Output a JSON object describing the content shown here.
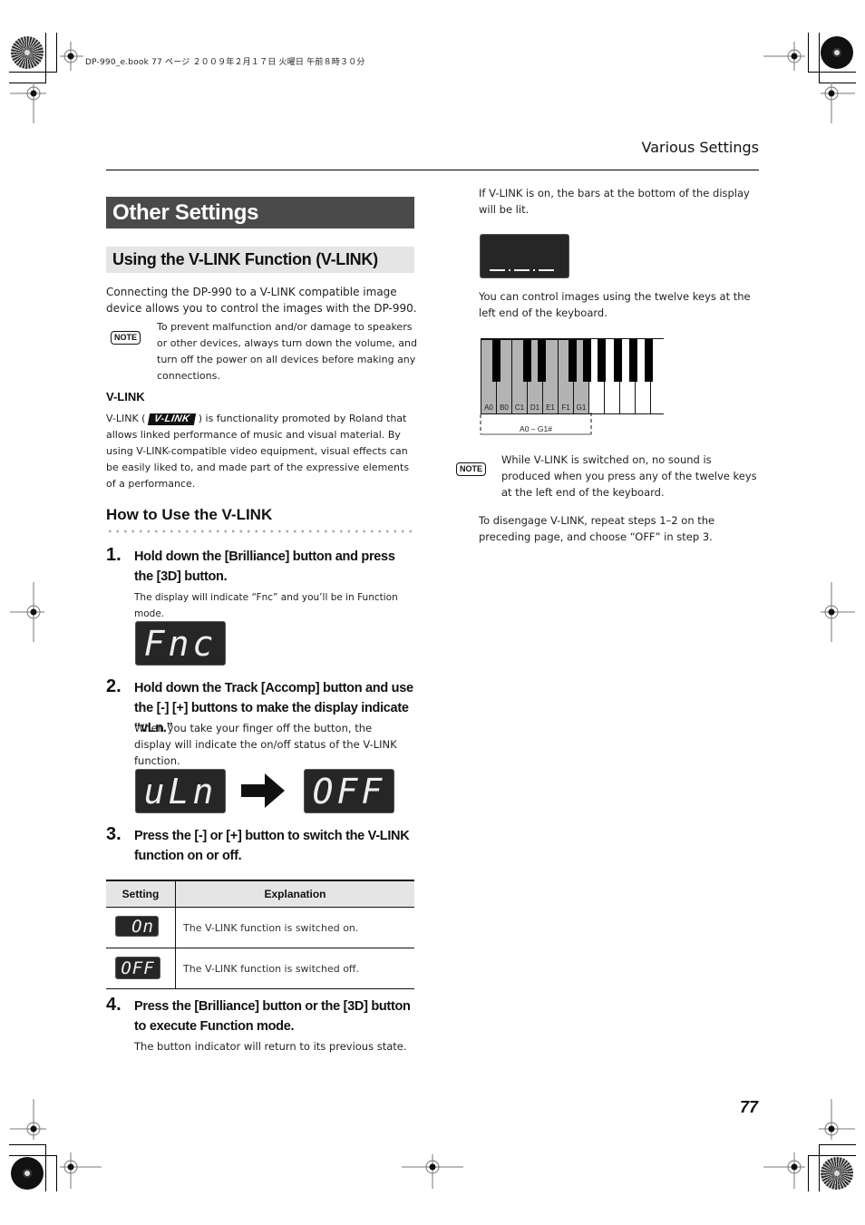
{
  "print_info": "DP-990_e.book  77 ページ  ２００９年２月１７日  火曜日  午前８時３０分",
  "running_head": "Various Settings",
  "page_number": "77",
  "title": "Other Settings",
  "section_title": "Using the V-LINK Function (V-LINK)",
  "intro": "Connecting the DP-990 to a V-LINK compatible image device allows you to control the images with the DP-990.",
  "note_label": "NOTE",
  "note1": "To prevent malfunction and/or damage to speakers or other devices, always turn down the volume, and turn off the power on all devices before making any connections.",
  "vlink": {
    "heading": "V-LINK",
    "text_before_logo": "V-LINK (",
    "logo": "V-LINK",
    "text_after_logo": ") is functionality promoted by Roland that allows linked performance of music and visual material. By using V-LINK-compatible video equipment, visual effects can be easily liked to, and made part of the expressive elements of a performance."
  },
  "howto_heading": "How to Use the V-LINK",
  "steps": [
    {
      "num": "1.",
      "title": "Hold down the [Brilliance] button and press the [3D] button.",
      "desc": "The display will indicate “Fnc” and you’ll be in Function mode.",
      "display": "Fnc"
    },
    {
      "num": "2.",
      "title": "Hold down the Track [Accomp] button and use the [-] [+] buttons to make the display indicate “vLn.”",
      "desc": "When you take your finger off the button, the display will indicate the on/off status of the V-LINK function.",
      "display_from": "uLn",
      "display_to": "OFF"
    },
    {
      "num": "3.",
      "title": "Press the [-] or [+] button to switch the V-LINK function on or off."
    },
    {
      "num": "4.",
      "title": "Press the [Brilliance] button or the [3D] button to execute Function mode.",
      "desc": "The button indicator will return to its previous state."
    }
  ],
  "settings_table": {
    "headers": [
      "Setting",
      "Explanation"
    ],
    "rows": [
      {
        "display": "On",
        "explanation": "The V-LINK function is switched on."
      },
      {
        "display": "OFF",
        "explanation": "The V-LINK function is switched off."
      }
    ]
  },
  "right": {
    "lit_text": "If V-LINK is on, the bars at the bottom of the display will be lit.",
    "lit_display": "_._._",
    "control_text": "You can control images using the twelve keys at the left end of the keyboard.",
    "keyboard": {
      "highlight_color": "#b3b3b3",
      "key_labels": [
        "A0",
        "B0",
        "C1",
        "D1",
        "E1",
        "F1",
        "G1"
      ],
      "range_label": "A0 – G1#"
    },
    "note2": "While V-LINK is switched on, no sound is produced when you press any of the twelve keys at the left end of the keyboard.",
    "disengage": "To disengage V-LINK, repeat steps 1–2 on the preceding page, and choose “OFF” in step 3."
  }
}
